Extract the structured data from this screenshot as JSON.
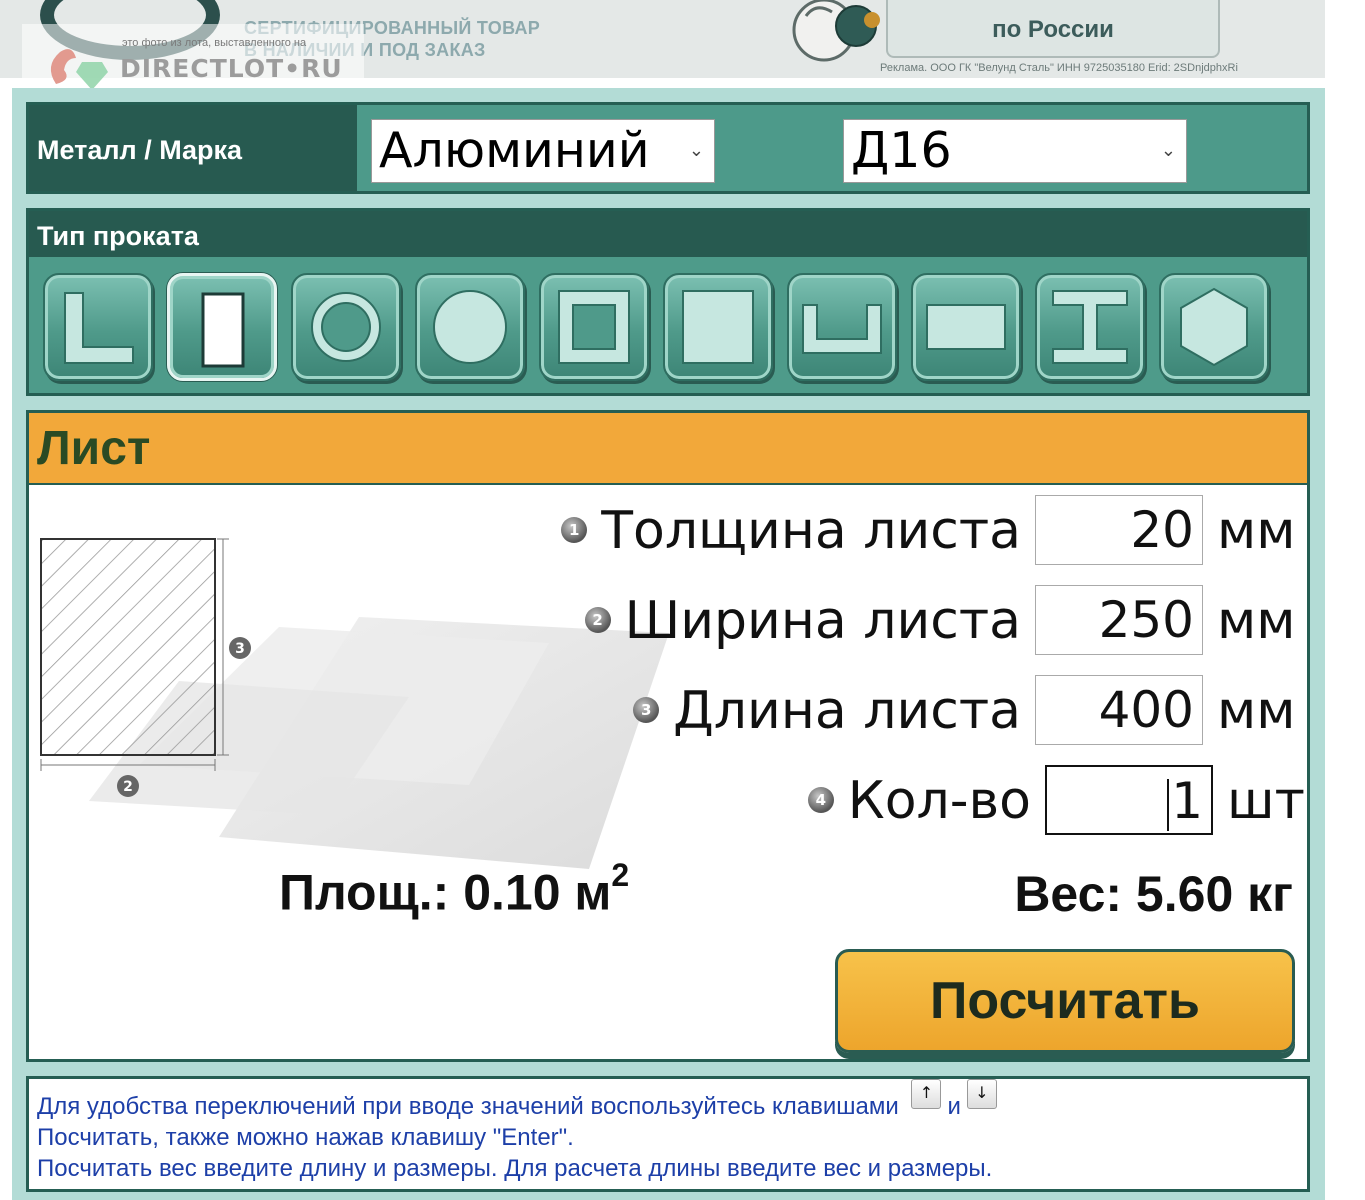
{
  "banner": {
    "line1": "СЕРТИФИЦИРОВАННЫЙ ТОВАР",
    "line2": "В НАЛИЧИИ И ПОД ЗАКАЗ",
    "cta": "по России",
    "legal": "Реклама. ООО ГК \"Велунд Сталь\" ИНН 9725035180 Erid: 2SDnjdphxRi"
  },
  "watermark": {
    "small": "это фото из лота, выставленного на",
    "big": "DIRECTLOT•RU"
  },
  "metal": {
    "label": "Металл / Марка",
    "metal_selected": "Алюминий",
    "grade_selected": "Д16"
  },
  "profile": {
    "label": "Тип проката",
    "types": [
      {
        "icon": "angle-icon",
        "active": false
      },
      {
        "icon": "sheet-icon",
        "active": true
      },
      {
        "icon": "pipe-icon",
        "active": false
      },
      {
        "icon": "round-bar-icon",
        "active": false
      },
      {
        "icon": "square-tube-icon",
        "active": false
      },
      {
        "icon": "square-bar-icon",
        "active": false
      },
      {
        "icon": "channel-icon",
        "active": false
      },
      {
        "icon": "strip-icon",
        "active": false
      },
      {
        "icon": "i-beam-icon",
        "active": false
      },
      {
        "icon": "hexagon-icon",
        "active": false
      }
    ]
  },
  "calc": {
    "title": "Лист",
    "fields": [
      {
        "num": "1",
        "label": "Толщина листа",
        "value": "20",
        "unit": "мм"
      },
      {
        "num": "2",
        "label": "Ширина листа",
        "value": "250",
        "unit": "мм"
      },
      {
        "num": "3",
        "label": "Длина листа",
        "value": "400",
        "unit": "мм"
      },
      {
        "num": "4",
        "label": "Кол-во",
        "value": "1",
        "unit": "шт"
      }
    ],
    "area_label": "Площ.: 0.10 м",
    "area_sup": "2",
    "weight": "Вес: 5.60 кг",
    "button": "Посчитать",
    "diagram_marks": [
      "3",
      "2"
    ]
  },
  "hint": {
    "line1_a": "Для удобства переключений при вводе значений воспользуйтесь клавишами",
    "key_up": "↑",
    "and": "и",
    "key_down": "↓",
    "line2": "Посчитать, также можно нажав клавишу \"Enter\".",
    "line3": "Посчитать вес введите длину и размеры. Для расчета длины введите вес и размеры."
  },
  "colors": {
    "frame": "#b3dcd6",
    "dark_green": "#275a50",
    "teal": "#4e9b8a",
    "orange": "#f2a83a",
    "hint_text": "#1d3fa8"
  }
}
